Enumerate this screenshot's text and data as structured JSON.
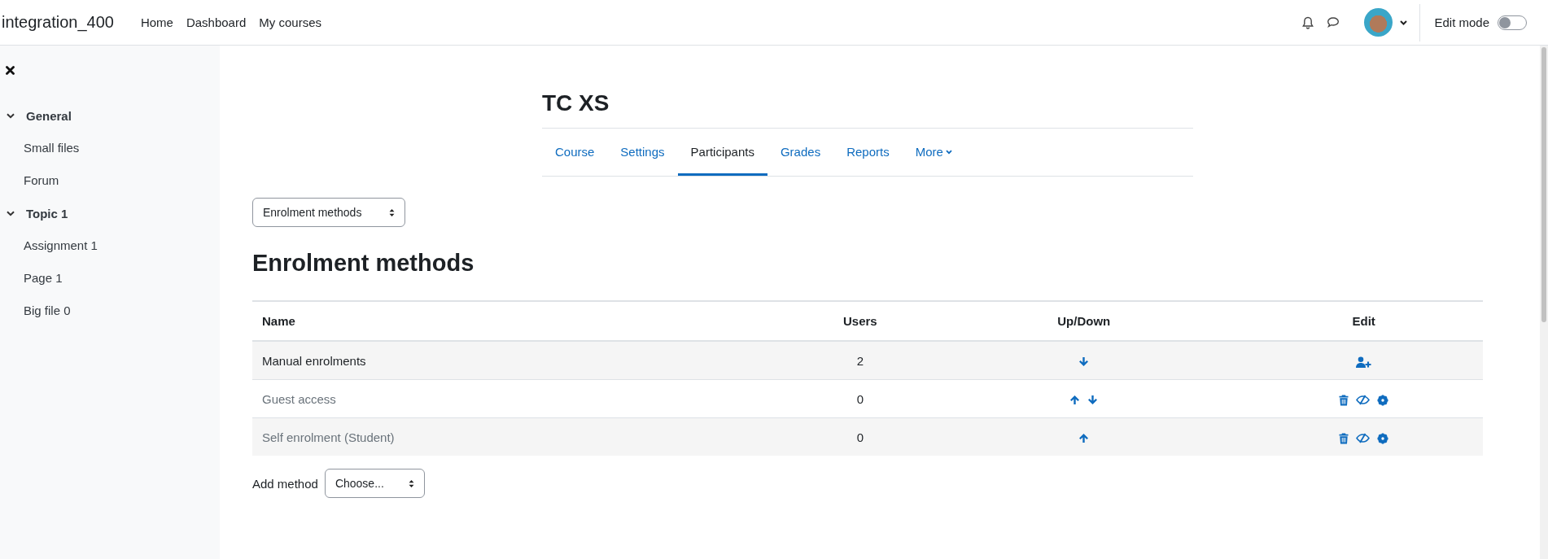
{
  "navbar": {
    "site_name": "integration_400",
    "links": [
      {
        "label": "Home"
      },
      {
        "label": "Dashboard"
      },
      {
        "label": "My courses"
      }
    ],
    "edit_mode": {
      "label": "Edit mode",
      "on": false
    }
  },
  "sidebar": {
    "sections": [
      {
        "label": "General",
        "expanded": true,
        "children": [
          {
            "label": "Small files"
          },
          {
            "label": "Forum"
          }
        ]
      },
      {
        "label": "Topic 1",
        "expanded": true,
        "children": [
          {
            "label": "Assignment 1"
          },
          {
            "label": "Page 1"
          },
          {
            "label": "Big file 0"
          }
        ]
      }
    ]
  },
  "course": {
    "title": "TC XS",
    "tabs": [
      {
        "label": "Course",
        "selected": false
      },
      {
        "label": "Settings",
        "selected": false
      },
      {
        "label": "Participants",
        "selected": true
      },
      {
        "label": "Grades",
        "selected": false
      },
      {
        "label": "Reports",
        "selected": false
      },
      {
        "label": "More",
        "selected": false,
        "kind": "dropdown"
      }
    ]
  },
  "page_select": {
    "value": "Enrolment methods"
  },
  "heading": "Enrolment methods",
  "table": {
    "columns": [
      "Name",
      "Users",
      "Up/Down",
      "Edit"
    ],
    "rows": [
      {
        "name": "Manual enrolments",
        "users": "2",
        "disabled": false,
        "up": false,
        "down": true,
        "edit_actions": [
          {
            "kind": "enrol"
          }
        ]
      },
      {
        "name": "Guest access",
        "users": "0",
        "disabled": true,
        "up": true,
        "down": true,
        "edit_actions": [
          {
            "kind": "delete"
          },
          {
            "kind": "hide"
          },
          {
            "kind": "settings"
          }
        ]
      },
      {
        "name": "Self enrolment (Student)",
        "users": "0",
        "disabled": true,
        "up": true,
        "down": false,
        "edit_actions": [
          {
            "kind": "delete"
          },
          {
            "kind": "hide"
          },
          {
            "kind": "settings"
          }
        ]
      }
    ]
  },
  "add_method": {
    "label": "Add method",
    "value": "Choose..."
  }
}
